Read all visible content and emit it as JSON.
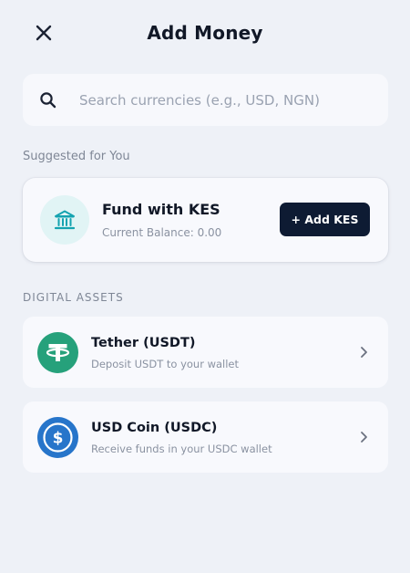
{
  "header": {
    "title": "Add Money",
    "close_icon": "close-icon"
  },
  "search": {
    "placeholder": "Search currencies (e.g., USD, NGN)",
    "value": "",
    "icon": "search-icon"
  },
  "suggested": {
    "label": "Suggested for You",
    "card": {
      "icon": "bank-icon",
      "title": "Fund with KES",
      "subtitle": "Current Balance: 0.00",
      "button_label": "+ Add KES"
    }
  },
  "digital_assets": {
    "label": "DIGITAL ASSETS",
    "items": [
      {
        "name": "Tether (USDT)",
        "description": "Deposit USDT to your wallet",
        "icon": "tether-logo-icon",
        "color": "#26a17b"
      },
      {
        "name": "USD Coin (USDC)",
        "description": "Receive funds in your USDC wallet",
        "icon": "usdc-logo-icon",
        "color": "#2775ca"
      }
    ]
  },
  "colors": {
    "background": "#eef1f7",
    "card": "#f8f9fd",
    "primary_button": "#0e1b33",
    "bank_icon_teal": "#14a3b0"
  }
}
